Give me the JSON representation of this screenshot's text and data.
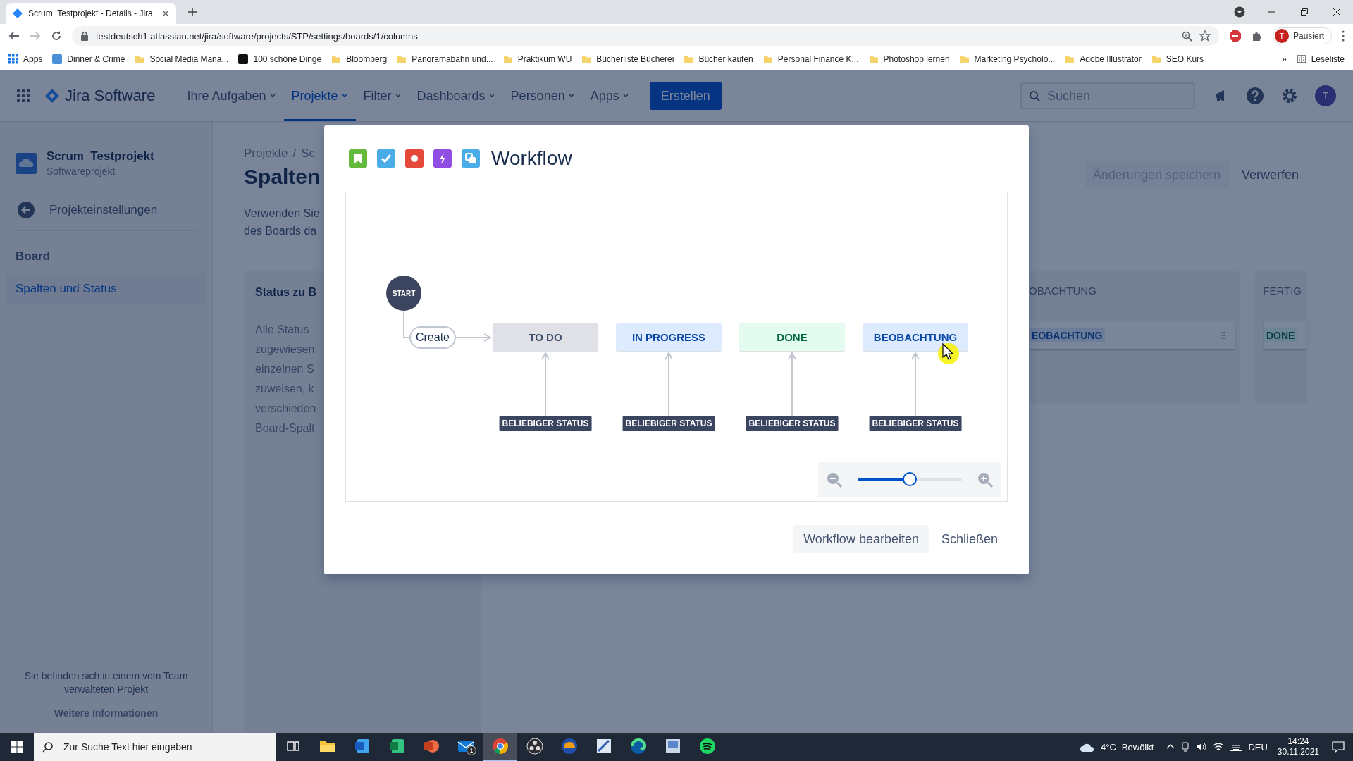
{
  "browser": {
    "tab": {
      "title": "Scrum_Testprojekt - Details - Jira"
    },
    "url": "testdeutsch1.atlassian.net/jira/software/projects/STP/settings/boards/1/columns",
    "profile": {
      "initial": "T",
      "label": "Pausiert"
    },
    "bookmarks": [
      {
        "label": "Apps",
        "kind": "apps"
      },
      {
        "label": "Dinner & Crime",
        "kind": "site",
        "color": "#4a90d9"
      },
      {
        "label": "Social Media Mana...",
        "kind": "folder"
      },
      {
        "label": "100 schöne Dinge",
        "kind": "site",
        "color": "#111111"
      },
      {
        "label": "Bloomberg",
        "kind": "folder"
      },
      {
        "label": "Panoramabahn und...",
        "kind": "folder"
      },
      {
        "label": "Praktikum WU",
        "kind": "folder"
      },
      {
        "label": "Bücherliste Bücherei",
        "kind": "folder"
      },
      {
        "label": "Bücher kaufen",
        "kind": "folder"
      },
      {
        "label": "Personal Finance K...",
        "kind": "folder"
      },
      {
        "label": "Photoshop lernen",
        "kind": "folder"
      },
      {
        "label": "Marketing Psycholo...",
        "kind": "folder"
      },
      {
        "label": "Adobe Illustrator",
        "kind": "folder"
      },
      {
        "label": "SEO Kurs",
        "kind": "folder"
      }
    ],
    "more": "»",
    "reading_list": "Leseliste"
  },
  "jira": {
    "product": "Jira Software",
    "nav": [
      {
        "label": "Ihre Aufgaben",
        "selected": false
      },
      {
        "label": "Projekte",
        "selected": true
      },
      {
        "label": "Filter",
        "selected": false
      },
      {
        "label": "Dashboards",
        "selected": false
      },
      {
        "label": "Personen",
        "selected": false
      },
      {
        "label": "Apps",
        "selected": false
      }
    ],
    "create_button": "Erstellen",
    "search": {
      "placeholder": "Suchen"
    },
    "avatar": "T"
  },
  "sidebar": {
    "project": {
      "name": "Scrum_Testprojekt",
      "type": "Softwareprojekt"
    },
    "back_link": "Projekteinstellungen",
    "section": "Board",
    "items": [
      {
        "label": "Spalten und Status",
        "selected": true
      }
    ],
    "footer": {
      "text": "Sie befinden sich in einem vom Team verwalteten Projekt",
      "link": "Weitere Informationen"
    }
  },
  "page": {
    "breadcrumbs": [
      "Projekte",
      "Sc"
    ],
    "breadcrumb_separator": "/",
    "title": "Spalten",
    "description": [
      "Verwenden Sie",
      "des Boards da"
    ],
    "actions": [
      {
        "label": "Änderungen speichern",
        "disabled": true
      },
      {
        "label": "Verwerfen",
        "disabled": false
      }
    ],
    "status_panel": {
      "title": "Status zu B",
      "text": [
        "Alle Status",
        "zugewiesen",
        "einzelnen S",
        "zuweisen, k",
        "verschieden",
        "Board-Spalt"
      ]
    },
    "columns": [
      {
        "title": "OBACHTUNG",
        "cards": [
          {
            "label": "EOBACHTUNG",
            "color": "#6b7c99"
          }
        ]
      },
      {
        "title": "FERTIG",
        "cards": [
          {
            "label": "DONE",
            "color": "#6d8492"
          }
        ]
      }
    ]
  },
  "modal": {
    "title": "Workflow",
    "diagram": {
      "start": "START",
      "transition": "Create",
      "statuses": [
        {
          "name": "TO DO",
          "color": "#dfe1e6",
          "from": "BELIEBIGER STATUS"
        },
        {
          "name": "IN PROGRESS",
          "color": "#deebff",
          "from": "BELIEBIGER STATUS"
        },
        {
          "name": "DONE",
          "color": "#e3fcef",
          "from": "BELIEBIGER STATUS"
        },
        {
          "name": "BEOBACHTUNG",
          "color": "#deebff",
          "from": "BELIEBIGER STATUS"
        }
      ]
    },
    "zoom": {
      "level": 0.5
    },
    "buttons": [
      {
        "label": "Workflow bearbeiten",
        "kind": "secondary"
      },
      {
        "label": "Schließen",
        "kind": "subtle"
      }
    ]
  },
  "taskbar": {
    "search": {
      "placeholder": "Zur Suche Text hier eingeben"
    },
    "apps": [
      {
        "kind": "taskview",
        "active": false
      },
      {
        "kind": "explorer",
        "active": false
      },
      {
        "kind": "word",
        "active": false
      },
      {
        "kind": "excel",
        "active": false
      },
      {
        "kind": "powerpoint",
        "active": false
      },
      {
        "kind": "mail",
        "active": false,
        "badge": "1"
      },
      {
        "kind": "chrome",
        "active": true
      },
      {
        "kind": "obs",
        "active": false
      },
      {
        "kind": "helmet",
        "active": false
      },
      {
        "kind": "tool",
        "active": false
      },
      {
        "kind": "edge",
        "active": false
      },
      {
        "kind": "viewer",
        "active": false
      },
      {
        "kind": "spotify",
        "active": false
      }
    ],
    "weather": {
      "temperature": "4°C",
      "condition": "Bewölkt"
    },
    "language": "DEU",
    "time": "14:24",
    "date": "30.11.2021"
  }
}
